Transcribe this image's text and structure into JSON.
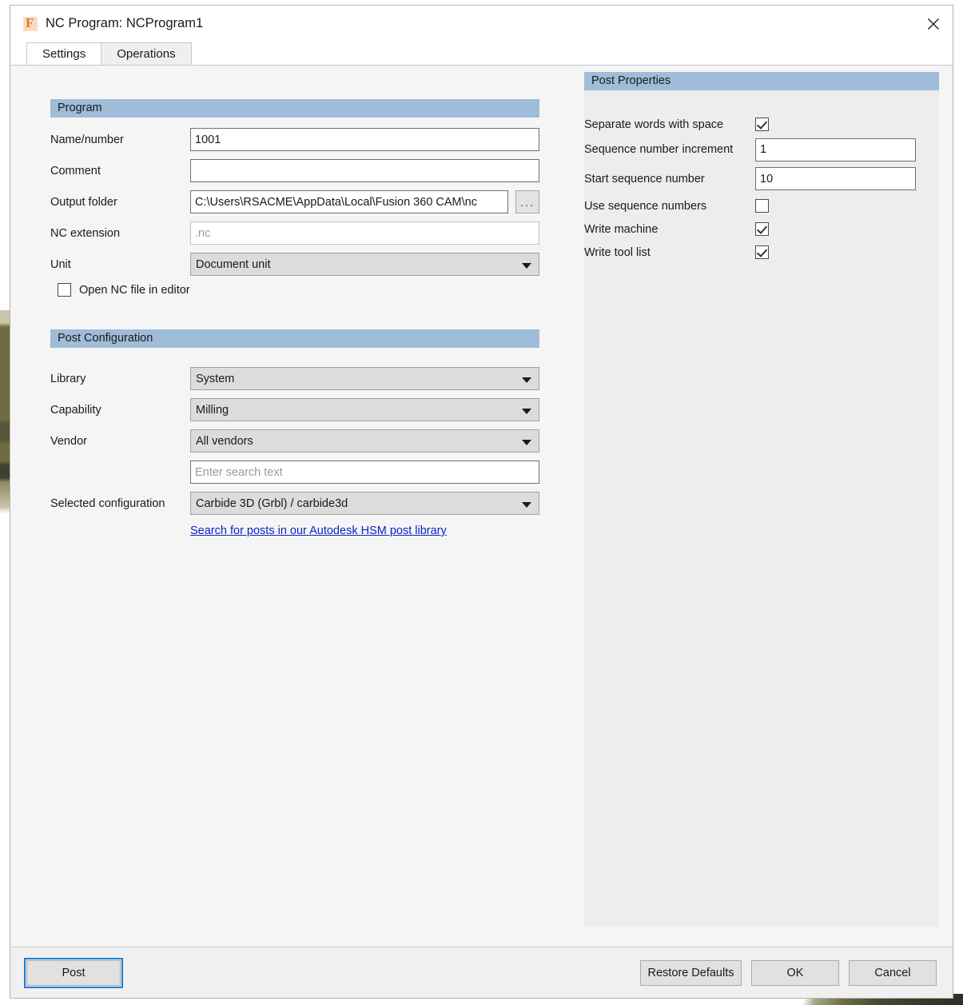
{
  "window": {
    "title": "NC Program: NCProgram1",
    "app_icon": "fusion-f-icon",
    "close_icon": "close-icon"
  },
  "tabs": [
    {
      "label": "Settings",
      "active": true
    },
    {
      "label": "Operations",
      "active": false
    }
  ],
  "program": {
    "header": "Program",
    "fields": {
      "name_number": {
        "label": "Name/number",
        "value": "1001",
        "placeholder": ""
      },
      "comment": {
        "label": "Comment",
        "value": "",
        "placeholder": ""
      },
      "output_folder": {
        "label": "Output folder",
        "value": "C:\\Users\\RSACME\\AppData\\Local\\Fusion 360 CAM\\nc",
        "browse_label": "..."
      },
      "nc_extension": {
        "label": "NC extension",
        "value": "",
        "placeholder": ".nc"
      },
      "unit": {
        "label": "Unit",
        "value": "Document unit"
      }
    },
    "open_nc_in_editor": {
      "label": "Open NC file in editor",
      "checked": false
    }
  },
  "post_configuration": {
    "header": "Post Configuration",
    "library": {
      "label": "Library",
      "value": "System"
    },
    "capability": {
      "label": "Capability",
      "value": "Milling"
    },
    "vendor": {
      "label": "Vendor",
      "value": "All vendors"
    },
    "search": {
      "value": "",
      "placeholder": "Enter search text"
    },
    "selected_configuration": {
      "label": "Selected configuration",
      "value": "Carbide 3D (Grbl) / carbide3d"
    },
    "library_link": "Search for posts in our Autodesk HSM post library"
  },
  "post_properties": {
    "header": "Post Properties",
    "items": [
      {
        "label": "Separate words with space",
        "type": "checkbox",
        "checked": true
      },
      {
        "label": "Sequence number increment",
        "type": "text",
        "value": "1"
      },
      {
        "label": "Start sequence number",
        "type": "text",
        "value": "10"
      },
      {
        "label": "Use sequence numbers",
        "type": "checkbox",
        "checked": false
      },
      {
        "label": "Write machine",
        "type": "checkbox",
        "checked": true
      },
      {
        "label": "Write tool list",
        "type": "checkbox",
        "checked": true
      }
    ]
  },
  "footer": {
    "post": "Post",
    "restore_defaults": "Restore Defaults",
    "ok": "OK",
    "cancel": "Cancel"
  },
  "colors": {
    "section_header": "#9fbcd8",
    "link": "#0b23c8",
    "focus_outline": "#1c7fd6",
    "accent_icon": "#e07b2e"
  }
}
